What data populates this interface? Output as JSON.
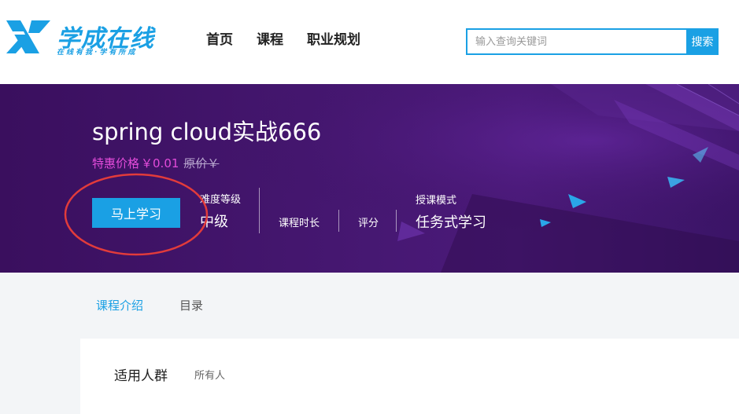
{
  "header": {
    "logo": {
      "text": "学成在线",
      "slogan": "在线有我·学有所成",
      "color": "#1aa0e4"
    },
    "nav": [
      {
        "label": "首页"
      },
      {
        "label": "课程"
      },
      {
        "label": "职业规划"
      }
    ],
    "search": {
      "placeholder": "输入查询关键词",
      "button_label": "搜索"
    }
  },
  "course": {
    "title": "spring cloud实战666",
    "price_label": "特惠价格",
    "price_value": "￥0.01",
    "original_price": "原价￥",
    "learn_button": "马上学习",
    "difficulty": {
      "label": "难度等级",
      "value": "中级"
    },
    "duration": {
      "label": "课程时长"
    },
    "rating": {
      "label": "评分"
    },
    "teach_mode": {
      "label": "授课模式",
      "value": "任务式学习"
    }
  },
  "tabs": [
    {
      "label": "课程介绍",
      "active": true
    },
    {
      "label": "目录",
      "active": false
    }
  ],
  "content": {
    "audience_title": "适用人群",
    "audience_value": "所有人"
  },
  "colors": {
    "accent": "#1aa0e4",
    "price": "#e24bd9",
    "banner": "#451770",
    "annotation": "#e23b3b"
  }
}
